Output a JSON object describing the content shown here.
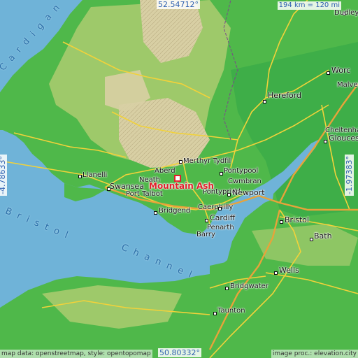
{
  "map": {
    "marker": {
      "label": "Mountain Ash",
      "color": "#e0202a"
    },
    "coords": {
      "top": "52.54712°",
      "bottom": "50.80332°",
      "left": "-4.78633°",
      "right": "-1.97383°"
    },
    "scale": "194 km = 120 mi",
    "attribution_left": "map data: openstreetmap, style: opentopomap",
    "attribution_right": "image proc.: elevation.city",
    "water_labels": {
      "bay": "Cardigan",
      "channel_1": "Bristol",
      "channel_2": "Channel"
    },
    "towns": {
      "dudley": "Dudley",
      "worcester": "Worc",
      "malvern": "Malvern",
      "hereford": "Hereford",
      "cheltenham": "Cheltenha",
      "gloucester": "Glouces",
      "merthyr": "Merthyr Tydfil",
      "aberdare": "Aberd",
      "neath": "Neath",
      "llanelli": "Llanelli",
      "swansea": "Swansea",
      "port_talbot": "Port Talbot",
      "pontypool": "Pontypool",
      "cwmbran": "Cwmbran",
      "pontypridd": "Pontypridd",
      "newport": "Newport",
      "bridgend": "Bridgend",
      "caerphilly": "Caerphilly",
      "cardiff": "Cardiff",
      "penarth": "Penarth",
      "barry": "Barry",
      "bristol": "Bristol",
      "bath": "Bath",
      "wells": "Wells",
      "bridgwater": "Bridgwater",
      "taunton": "Taunton"
    },
    "colors": {
      "sea": "#6fb3d8",
      "lowland": "#4fb84a",
      "upland": "#9ec96a",
      "highland": "#d8cfa4",
      "roads": "#f2d23a",
      "motorway": "#e8a33a"
    }
  }
}
